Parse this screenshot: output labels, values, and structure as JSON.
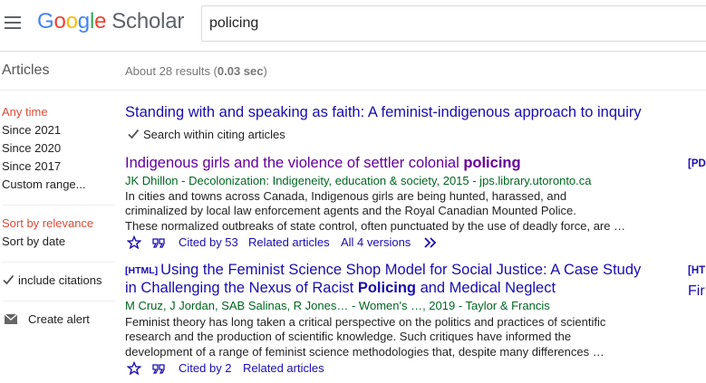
{
  "header": {
    "logo_word_google": "Google",
    "logo_word_scholar": "Scholar",
    "search_value": "policing"
  },
  "subheader": {
    "section_label": "Articles",
    "results_prefix": "About 28 results (",
    "results_time": "0.03 sec",
    "results_suffix": ")"
  },
  "sidebar": {
    "time_filters": [
      {
        "label": "Any time",
        "active": true
      },
      {
        "label": "Since 2021",
        "active": false
      },
      {
        "label": "Since 2020",
        "active": false
      },
      {
        "label": "Since 2017",
        "active": false
      },
      {
        "label": "Custom range...",
        "active": false
      }
    ],
    "sort_options": [
      {
        "label": "Sort by relevance",
        "active": true
      },
      {
        "label": "Sort by date",
        "active": false
      }
    ],
    "include_citations": "include citations",
    "create_alert": "Create alert"
  },
  "citing": {
    "title": "Standing with and speaking as faith: A feminist-indigenous approach to inquiry",
    "search_within": "Search within citing articles"
  },
  "results": [
    {
      "title_pre": "Indigenous girls and the violence of settler colonial ",
      "title_bold": "policing",
      "title_post": "",
      "authors": "JK Dhillon - Decolonization: Indigeneity, education & society, 2015 - jps.library.utoronto.ca",
      "snippet": [
        "In cities and towns across Canada, Indigenous girls are being hunted, harassed, and",
        "criminalized by local law enforcement agents and the Royal Canadian Mounted Police.",
        "These normalized outbreaks of state control, often punctuated by the use of deadly force, are …"
      ],
      "cited_by": "Cited by 53",
      "related": "Related articles",
      "versions": "All 4 versions",
      "side_link": "[PD"
    },
    {
      "tag": "[HTML]",
      "title_line1": "Using the Feminist Science Shop Model for Social Justice: A Case Study",
      "title_line2_pre": "in Challenging the Nexus of Racist ",
      "title_line2_bold": "Policing",
      "title_line2_post": " and Medical Neglect",
      "authors": "M Cruz, J Jordan, SAB Salinas, R Jones… - Women's …, 2019 - Taylor & Francis",
      "snippet": [
        "Feminist theory has long taken a critical perspective on the politics and practices of scientific",
        "research and the production of scientific knowledge. Such critiques have informed the",
        "development of a range of feminist science methodologies that, despite many differences …"
      ],
      "cited_by": "Cited by 2",
      "related": "Related articles",
      "side_link": "[HT",
      "side_link2": "Fir"
    }
  ],
  "colors": {
    "link": "#1a0dab",
    "visited": "#660099",
    "green": "#006621",
    "active": "#dd4b39"
  }
}
